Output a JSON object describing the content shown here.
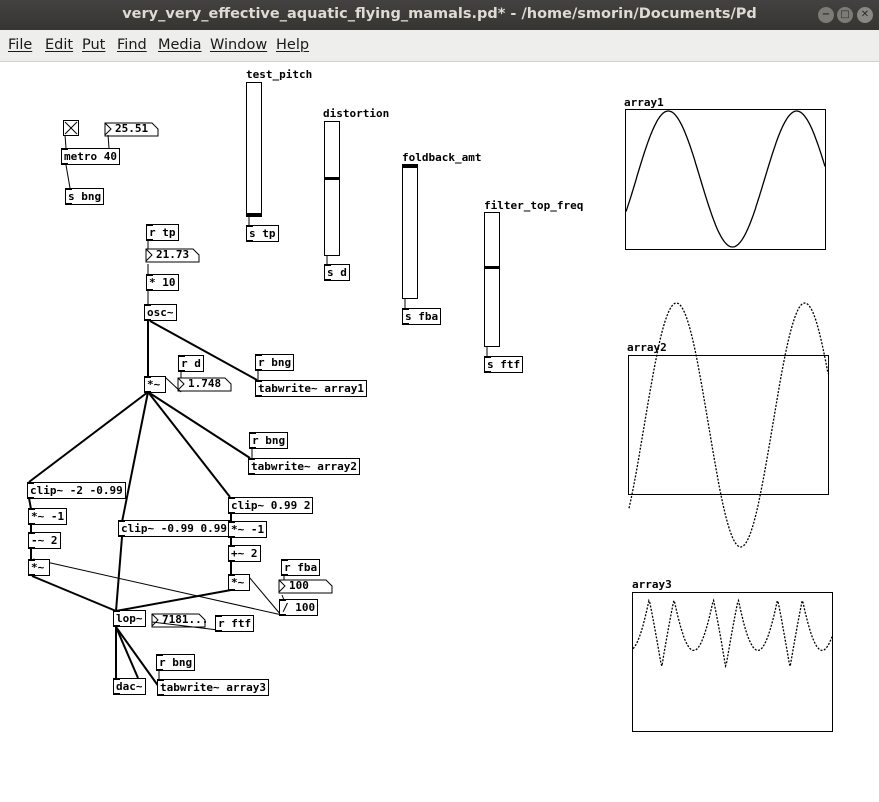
{
  "window": {
    "title": "very_very_effective_aquatic_flying_mamals.pd* - /home/smorin/Documents/Pd",
    "minimize_glyph": "−",
    "maximize_glyph": "□",
    "close_glyph": "✕"
  },
  "menu": [
    "File",
    "Edit",
    "Put",
    "Find",
    "Media",
    "Window",
    "Help"
  ],
  "objects": {
    "metro": "metro 40",
    "s_bng": "s bng",
    "r_tp": "r tp",
    "mul_10": "* 10",
    "osc": "osc~",
    "r_d": "r d",
    "mul_sig": "*~",
    "r_bng_1": "r bng",
    "tabwrite_1": "tabwrite~ array1",
    "r_bng_2": "r bng",
    "tabwrite_2": "tabwrite~ array2",
    "clip_low": "clip~ -2 -0.99",
    "mul_neg1_a": "*~ -1",
    "sub2": "-~ 2",
    "mul_a": "*~",
    "clip_mid": "clip~ -0.99 0.99",
    "clip_high": "clip~ 0.99 2",
    "mul_neg1_b": "*~ -1",
    "add2": "+~ 2",
    "mul_b": "*~",
    "r_fba": "r fba",
    "div100": "/ 100",
    "lop": "lop~",
    "r_ftf": "r ftf",
    "r_bng_3": "r bng",
    "dac": "dac~",
    "tabwrite_3": "tabwrite~ array3",
    "s_tp": "s tp",
    "s_d": "s d",
    "s_fba": "s fba",
    "s_ftf": "s ftf"
  },
  "numbers": {
    "metro_rate": "25.51",
    "tp_value": "21.73",
    "d_value": "1.748",
    "fba_value": "100",
    "ftf_value": "7181..."
  },
  "sliders": {
    "test_pitch": {
      "label": "test_pitch",
      "level": 0.0
    },
    "distortion": {
      "label": "distortion",
      "level": 0.58
    },
    "foldback_amt": {
      "label": "foldback_amt",
      "level": 1.0
    },
    "filter_top_freq": {
      "label": "filter_top_freq",
      "level": 0.59
    }
  },
  "arrays": {
    "array1": {
      "label": "array1"
    },
    "array2": {
      "label": "array2"
    },
    "array3": {
      "label": "array3"
    }
  },
  "colors": {
    "titlebar": "#3c3b37",
    "menubar": "#eeeeec",
    "canvas": "#ffffff",
    "ink": "#000000"
  }
}
